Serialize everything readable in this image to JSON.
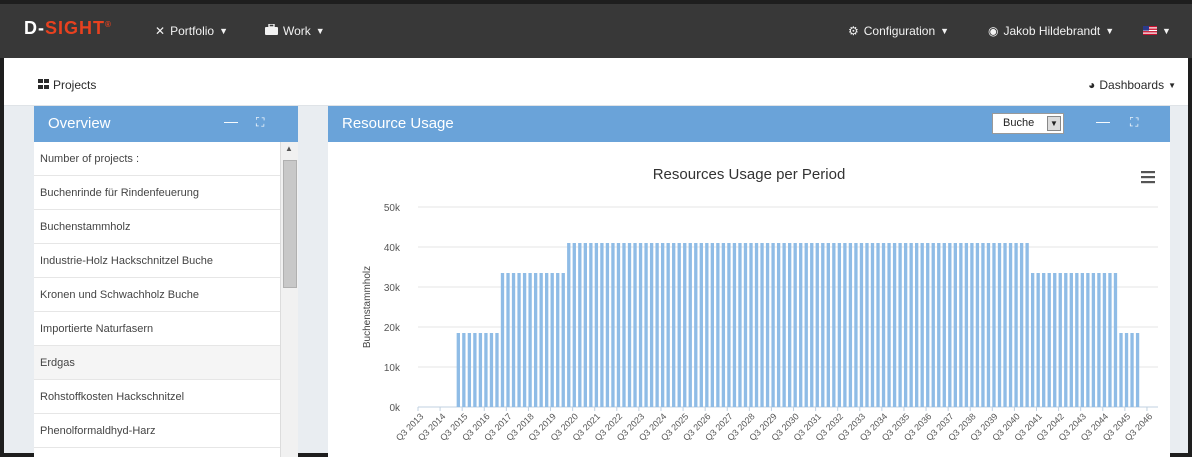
{
  "nav": {
    "logo_text": "D-",
    "logo_accent": "SIGHT",
    "portfolio": "Portfolio",
    "work": "Work",
    "configuration": "Configuration",
    "user": "Jakob Hildebrandt"
  },
  "subbar": {
    "projects": "Projects",
    "dashboards": "Dashboards"
  },
  "overview": {
    "title": "Overview",
    "rows": [
      "Number of projects :",
      "Buchenrinde für Rindenfeuerung",
      "Buchenstammholz",
      "Industrie-Holz Hackschnitzel Buche",
      "Kronen und Schwachholz Buche",
      "Importierte Naturfasern",
      "Erdgas",
      "Rohstoffkosten Hackschnitzel",
      "Phenolformaldhyd-Harz"
    ]
  },
  "resource": {
    "title": "Resource Usage",
    "select_value": "Buche"
  },
  "colors": {
    "accent": "#6aa3d9",
    "bar": "#8fbce6",
    "navbar": "#383838"
  },
  "chart_data": {
    "type": "bar",
    "title": "Resources Usage per Period",
    "ylabel": "Buchenstammholz",
    "ylim": [
      0,
      50000
    ],
    "yticks": [
      "0k",
      "10k",
      "20k",
      "30k",
      "40k",
      "50k"
    ],
    "xtick_labels": [
      "Q3 2013",
      "Q3 2014",
      "Q3 2015",
      "Q3 2016",
      "Q3 2017",
      "Q3 2018",
      "Q3 2019",
      "Q3 2020",
      "Q3 2021",
      "Q3 2022",
      "Q3 2023",
      "Q3 2024",
      "Q3 2025",
      "Q3 2026",
      "Q3 2027",
      "Q3 2028",
      "Q3 2029",
      "Q3 2030",
      "Q3 2031",
      "Q3 2032",
      "Q3 2033",
      "Q3 2034",
      "Q3 2035",
      "Q3 2036",
      "Q3 2037",
      "Q3 2038",
      "Q3 2039",
      "Q3 2040",
      "Q3 2041",
      "Q3 2042",
      "Q3 2043",
      "Q3 2044",
      "Q3 2045",
      "Q3 2046"
    ],
    "bars_per_year": 4,
    "yearly_values": [
      0,
      0,
      18500,
      18500,
      33500,
      33500,
      33500,
      41000,
      41000,
      41000,
      41000,
      41000,
      41000,
      41000,
      41000,
      41000,
      41000,
      41000,
      41000,
      41000,
      41000,
      41000,
      41000,
      41000,
      41000,
      41000,
      41000,
      41000,
      33500,
      33500,
      33500,
      33500,
      18500,
      0
    ],
    "grid": true,
    "legend": "none"
  }
}
